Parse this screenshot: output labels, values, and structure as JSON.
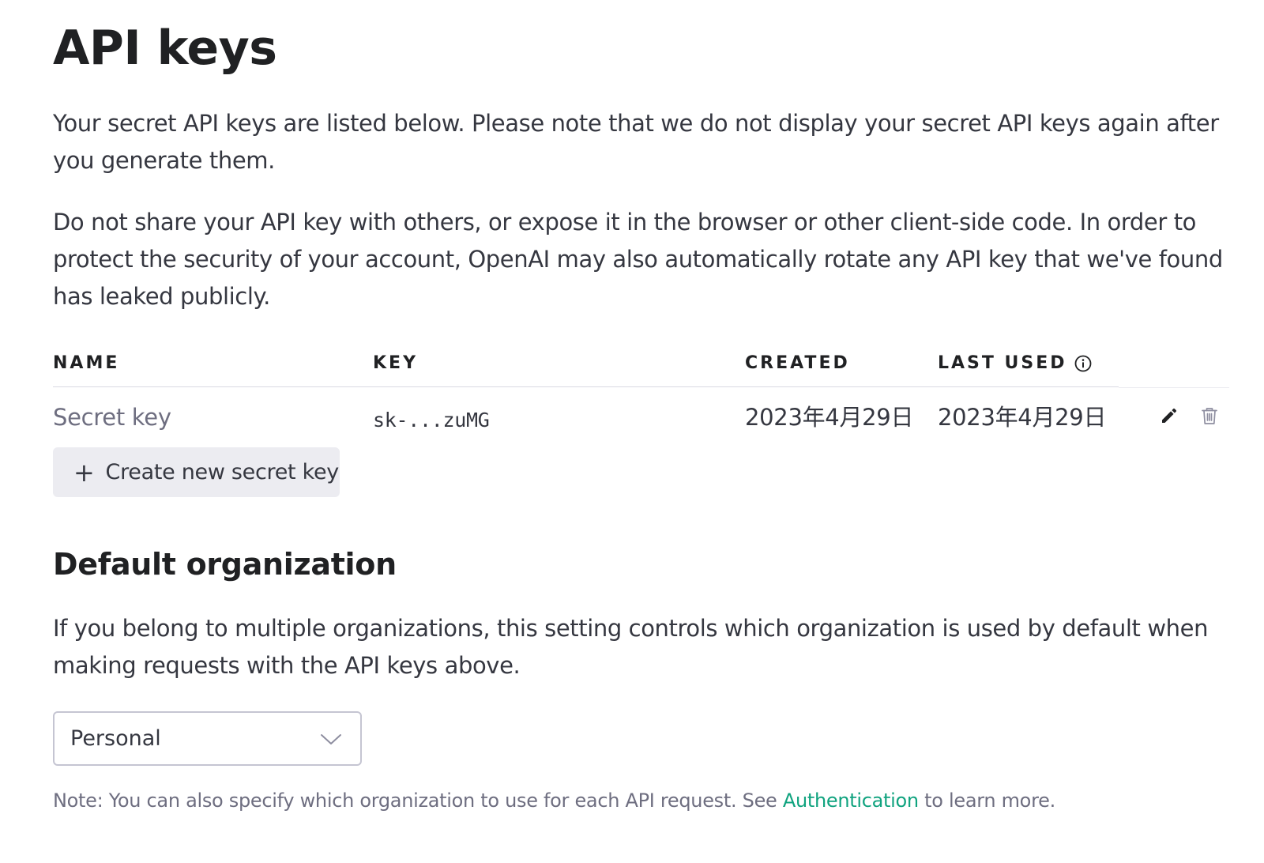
{
  "page": {
    "title": "API keys",
    "intro_1": "Your secret API keys are listed below. Please note that we do not display your secret API keys again after you generate them.",
    "intro_2": "Do not share your API key with others, or expose it in the browser or other client-side code. In order to protect the security of your account, OpenAI may also automatically rotate any API key that we've found has leaked publicly."
  },
  "table": {
    "headers": {
      "name": "NAME",
      "key": "KEY",
      "created": "CREATED",
      "last_used": "LAST USED"
    },
    "rows": [
      {
        "name": "Secret key",
        "key": "sk-...zuMG",
        "created": "2023年4月29日",
        "last_used": "2023年4月29日"
      }
    ],
    "create_button_label": "Create new secret key"
  },
  "default_org": {
    "heading": "Default organization",
    "description": "If you belong to multiple organizations, this setting controls which organization is used by default when making requests with the API keys above.",
    "selected": "Personal",
    "note_prefix": "Note: You can also specify which organization to use for each API request. See ",
    "note_link": "Authentication",
    "note_suffix": " to learn more."
  },
  "colors": {
    "link": "#10a37f",
    "button_bg": "#ececf1",
    "text": "#353740",
    "heading": "#202123"
  },
  "icons": {
    "plus": "plus-icon",
    "info": "info-icon",
    "edit": "pencil-icon",
    "delete": "trash-icon",
    "dropdown": "chevron-down-icon"
  }
}
